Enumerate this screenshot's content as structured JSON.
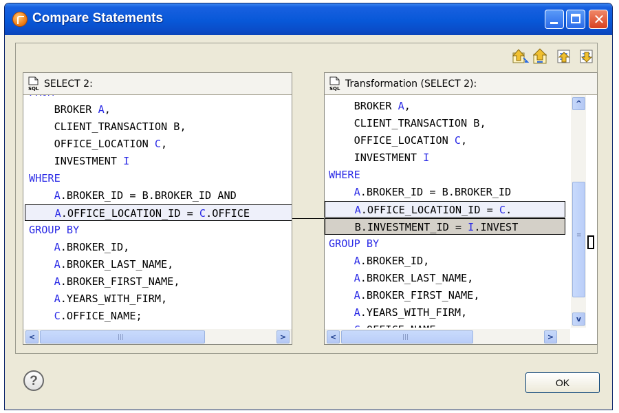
{
  "window": {
    "title": "Compare Statements"
  },
  "toolbar": {
    "icons": [
      "next-difference-icon",
      "previous-difference-icon",
      "next-change-icon",
      "previous-change-icon"
    ]
  },
  "left_panel": {
    "title": "SELECT 2:",
    "lines": [
      {
        "indent": "",
        "segments": [
          {
            "t": "FROM",
            "kw": true
          }
        ]
      },
      {
        "indent": "    ",
        "segments": [
          {
            "t": "BROKER ",
            "kw": false
          },
          {
            "t": "A",
            "kw": true
          },
          {
            "t": ",",
            "kw": false
          }
        ]
      },
      {
        "indent": "    ",
        "segments": [
          {
            "t": "CLIENT_TRANSACTION B,",
            "kw": false
          }
        ]
      },
      {
        "indent": "    ",
        "segments": [
          {
            "t": "OFFICE_LOCATION ",
            "kw": false
          },
          {
            "t": "C",
            "kw": true
          },
          {
            "t": ",",
            "kw": false
          }
        ]
      },
      {
        "indent": "    ",
        "segments": [
          {
            "t": "INVESTMENT ",
            "kw": false
          },
          {
            "t": "I",
            "kw": true
          }
        ]
      },
      {
        "indent": "",
        "segments": [
          {
            "t": "WHERE",
            "kw": true
          }
        ]
      },
      {
        "indent": "    ",
        "segments": [
          {
            "t": "A",
            "kw": true
          },
          {
            "t": ".BROKER_ID = B.BROKER_ID AND",
            "kw": false
          }
        ]
      },
      {
        "indent": "    ",
        "segments": [
          {
            "t": "A",
            "kw": true
          },
          {
            "t": ".OFFICE_LOCATION_ID = ",
            "kw": false
          },
          {
            "t": "C",
            "kw": true
          },
          {
            "t": ".OFFICE",
            "kw": false
          }
        ],
        "highlight": "box"
      },
      {
        "indent": "",
        "segments": [
          {
            "t": "GROUP BY",
            "kw": true
          }
        ]
      },
      {
        "indent": "    ",
        "segments": [
          {
            "t": "A",
            "kw": true
          },
          {
            "t": ".BROKER_ID,",
            "kw": false
          }
        ]
      },
      {
        "indent": "    ",
        "segments": [
          {
            "t": "A",
            "kw": true
          },
          {
            "t": ".BROKER_LAST_NAME,",
            "kw": false
          }
        ]
      },
      {
        "indent": "    ",
        "segments": [
          {
            "t": "A",
            "kw": true
          },
          {
            "t": ".BROKER_FIRST_NAME,",
            "kw": false
          }
        ]
      },
      {
        "indent": "    ",
        "segments": [
          {
            "t": "A",
            "kw": true
          },
          {
            "t": ".YEARS_WITH_FIRM,",
            "kw": false
          }
        ]
      },
      {
        "indent": "    ",
        "segments": [
          {
            "t": "C",
            "kw": true
          },
          {
            "t": ".OFFICE_NAME;",
            "kw": false
          }
        ]
      }
    ]
  },
  "right_panel": {
    "title": "Transformation (SELECT 2):",
    "lines": [
      {
        "indent": "    ",
        "segments": [
          {
            "t": "BROKER ",
            "kw": false
          },
          {
            "t": "A",
            "kw": true
          },
          {
            "t": ",",
            "kw": false
          }
        ]
      },
      {
        "indent": "    ",
        "segments": [
          {
            "t": "CLIENT_TRANSACTION B,",
            "kw": false
          }
        ]
      },
      {
        "indent": "    ",
        "segments": [
          {
            "t": "OFFICE_LOCATION ",
            "kw": false
          },
          {
            "t": "C",
            "kw": true
          },
          {
            "t": ",",
            "kw": false
          }
        ]
      },
      {
        "indent": "    ",
        "segments": [
          {
            "t": "INVESTMENT ",
            "kw": false
          },
          {
            "t": "I",
            "kw": true
          }
        ]
      },
      {
        "indent": "",
        "segments": [
          {
            "t": "WHERE",
            "kw": true
          }
        ]
      },
      {
        "indent": "    ",
        "segments": [
          {
            "t": "A",
            "kw": true
          },
          {
            "t": ".BROKER_ID = B.BROKER_ID",
            "kw": false
          }
        ]
      },
      {
        "indent": "    ",
        "segments": [
          {
            "t": "A",
            "kw": true
          },
          {
            "t": ".OFFICE_LOCATION_ID = ",
            "kw": false
          },
          {
            "t": "C",
            "kw": true
          },
          {
            "t": ".",
            "kw": false
          }
        ],
        "highlight": "box"
      },
      {
        "indent": "    ",
        "segments": [
          {
            "t": "B.INVESTMENT_ID = ",
            "kw": false
          },
          {
            "t": "I",
            "kw": true
          },
          {
            "t": ".INVEST",
            "kw": false
          }
        ],
        "highlight": "gray"
      },
      {
        "indent": "",
        "segments": [
          {
            "t": "GROUP BY",
            "kw": true
          }
        ]
      },
      {
        "indent": "    ",
        "segments": [
          {
            "t": "A",
            "kw": true
          },
          {
            "t": ".BROKER_ID,",
            "kw": false
          }
        ]
      },
      {
        "indent": "    ",
        "segments": [
          {
            "t": "A",
            "kw": true
          },
          {
            "t": ".BROKER_LAST_NAME,",
            "kw": false
          }
        ]
      },
      {
        "indent": "    ",
        "segments": [
          {
            "t": "A",
            "kw": true
          },
          {
            "t": ".BROKER_FIRST_NAME,",
            "kw": false
          }
        ]
      },
      {
        "indent": "    ",
        "segments": [
          {
            "t": "A",
            "kw": true
          },
          {
            "t": ".YEARS_WITH_FIRM,",
            "kw": false
          }
        ]
      },
      {
        "indent": "    ",
        "segments": [
          {
            "t": "C",
            "kw": true
          },
          {
            "t": ".OFFICE_NAME",
            "kw": false
          }
        ]
      }
    ]
  },
  "buttons": {
    "ok": "OK",
    "help": "?"
  },
  "colors": {
    "keyword": "#2a2ae6",
    "title_bar": "#0858d8",
    "dialog_bg": "#ece9d8"
  }
}
